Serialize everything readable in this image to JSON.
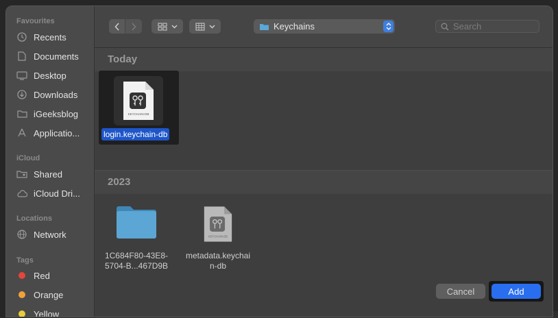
{
  "sidebar": {
    "favourites_heading": "Favourites",
    "favourites": [
      {
        "label": "Recents",
        "icon": "clock-icon"
      },
      {
        "label": "Documents",
        "icon": "document-icon"
      },
      {
        "label": "Desktop",
        "icon": "desktop-icon"
      },
      {
        "label": "Downloads",
        "icon": "download-icon"
      },
      {
        "label": "iGeeksblog",
        "icon": "folder-icon"
      },
      {
        "label": "Applicatio...",
        "icon": "applications-icon"
      }
    ],
    "icloud_heading": "iCloud",
    "icloud": [
      {
        "label": "Shared",
        "icon": "shared-folder-icon"
      },
      {
        "label": "iCloud Dri...",
        "icon": "cloud-icon"
      }
    ],
    "locations_heading": "Locations",
    "locations": [
      {
        "label": "Network",
        "icon": "globe-icon"
      }
    ],
    "tags_heading": "Tags",
    "tags": [
      {
        "label": "Red",
        "color": "#e5453a"
      },
      {
        "label": "Orange",
        "color": "#f0a23a"
      },
      {
        "label": "Yellow",
        "color": "#e8cc3b"
      }
    ]
  },
  "toolbar": {
    "path_label": "Keychains",
    "search_placeholder": "Search"
  },
  "content": {
    "groups": [
      {
        "heading": "Today",
        "files": [
          {
            "name": "login.keychain-db",
            "kind": "keychain",
            "selected": true,
            "badge": "KEYCHAIN-DB"
          }
        ]
      },
      {
        "heading": "2023",
        "files": [
          {
            "name_line1": "1C684F80-43E8-",
            "name_line2": "5704-B...467D9B",
            "kind": "folder"
          },
          {
            "name_line1": "metadata.keychai",
            "name_line2": "n-db",
            "kind": "keychain",
            "badge": "KEYCHAIN-DB"
          }
        ]
      }
    ]
  },
  "footer": {
    "cancel_label": "Cancel",
    "add_label": "Add"
  },
  "colors": {
    "accent": "#1e56c9",
    "add_button": "#2a6ef0",
    "folder": "#4a9bc8"
  }
}
